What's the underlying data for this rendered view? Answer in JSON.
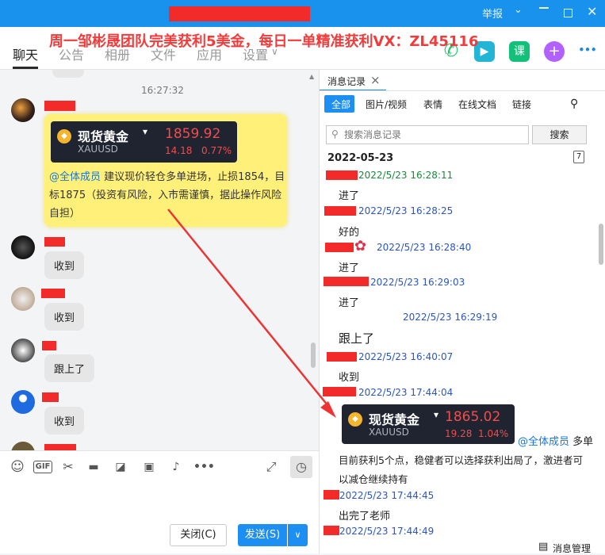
{
  "titlebar": {
    "report_label": "举报",
    "minimize_icon": "minimize-icon",
    "maximize_icon": "maximize-icon",
    "close_icon": "close-icon",
    "chevron_icon": "chevron-down-icon"
  },
  "nav": {
    "tabs": [
      {
        "label": "聊天",
        "active": true
      },
      {
        "label": "公告"
      },
      {
        "label": "相册"
      },
      {
        "label": "文件"
      },
      {
        "label": "应用"
      },
      {
        "label": "设置"
      }
    ],
    "settings_chevron": "∨",
    "promo": "周一邹彬晟团队完美获利5美金，每日一单精准获利VX：ZL45116",
    "course_label": "课",
    "plus_label": "+",
    "more_label": "•••"
  },
  "chat": {
    "timestamp": "16:27:32",
    "quote_card": {
      "name": "现货黄金",
      "symbol": "XAUUSD",
      "price": "1859.92",
      "change": "14.18",
      "change_pct": "0.77%"
    },
    "announcement": {
      "mention": "@全体成员",
      "text": " 建议现价轻仓多单进场，止损1854，目标1875（投资有风险，入市需谨慎，据此操作风险自担）"
    },
    "messages": [
      {
        "text": "收到"
      },
      {
        "text": "收到"
      },
      {
        "text": "跟上了"
      },
      {
        "text": "收到"
      }
    ]
  },
  "toolbar": {
    "gif_label": "GIF",
    "more_label": "•••"
  },
  "actions": {
    "close_label": "关闭(C)",
    "send_label": "发送(S)",
    "send_chevron": "∨"
  },
  "history": {
    "title": "消息记录",
    "close_icon": "×",
    "tabs": [
      "全部",
      "图片/视频",
      "表情",
      "在线文档",
      "链接"
    ],
    "search_placeholder": "搜索消息记录",
    "search_button": "搜索",
    "date_header": "2022-05-23",
    "calendar_label": "7",
    "entries": [
      {
        "time": "2022/5/23 16:28:11",
        "text": "进了"
      },
      {
        "time": "2022/5/23 16:28:25",
        "text": "好的"
      },
      {
        "time": "2022/5/23 16:28:40",
        "text": "进了"
      },
      {
        "time": "2022/5/23 16:29:03",
        "text": "进了"
      },
      {
        "time": "2022/5/23 16:29:19",
        "text": "跟上了"
      },
      {
        "time": "2022/5/23 16:40:07",
        "text": "收到"
      },
      {
        "time": "2022/5/23 17:44:04",
        "text": ""
      },
      {
        "time": "2022/5/23 17:44:45",
        "text": "出完了老师"
      },
      {
        "time": "2022/5/23 17:44:49",
        "text": ""
      }
    ],
    "quote_card": {
      "name": "现货黄金",
      "symbol": "XAUUSD",
      "price": "1865.02",
      "change": "19.28",
      "change_pct": "1.04%"
    },
    "followup": {
      "mention": "@全体成员",
      "suffix": " 多单",
      "line2": "目前获利5个点，稳健者可以选择获利出局了，激进者可",
      "line3": "以减仓继续持有"
    },
    "manage_label": "消息管理"
  }
}
